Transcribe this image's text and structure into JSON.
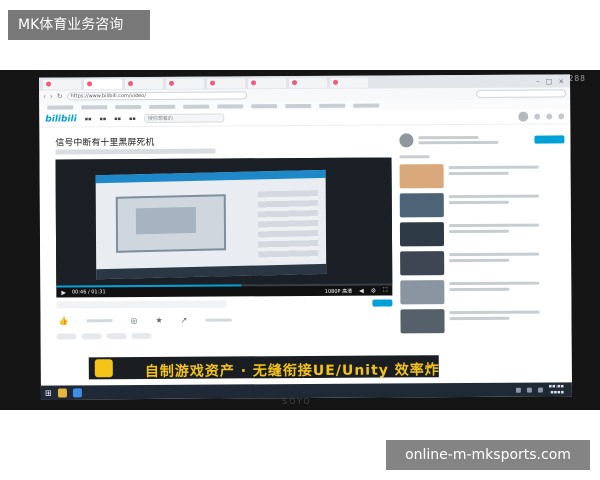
{
  "overlay": {
    "top_caption": "MK体育业务咨询",
    "bottom_caption": "online-m-mksports.com"
  },
  "monitor": {
    "model_tag": "H288",
    "brand": "SOYO"
  },
  "browser": {
    "url": "https://www.bilibili.com/video/"
  },
  "site": {
    "logo": "bilibili",
    "search_placeholder": "搜你想看的"
  },
  "video": {
    "title": "信号中断有十里黑屏死机",
    "time": "00:46 / 01:31",
    "quality": "1080P 高清"
  },
  "banner": {
    "text": "自制游戏资产 · 无缝衔接UE/Unity 效率炸裂"
  },
  "colors": {
    "accent": "#00a1d6",
    "banner_text": "#f3c317",
    "overlay_bg": "#5a5a5a"
  },
  "icons": [
    "like-icon",
    "coin-icon",
    "star-icon",
    "share-icon",
    "play-icon",
    "fullscreen-icon",
    "windows-start-icon"
  ]
}
